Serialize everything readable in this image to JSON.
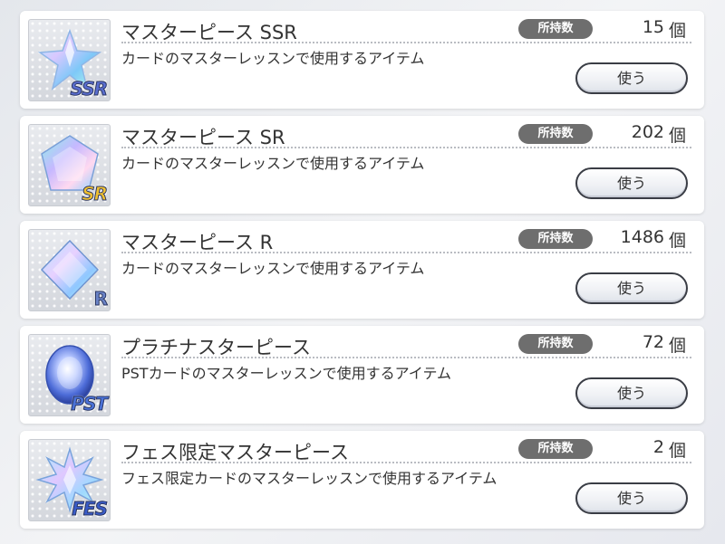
{
  "items": [
    {
      "name": "マスターピース SSR",
      "description": "カードのマスターレッスンで使用するアイテム",
      "own_label": "所持数",
      "count": "15",
      "unit": "個",
      "button": "使う",
      "badge": "SSR",
      "icon": "ssr-star-crystal-icon"
    },
    {
      "name": "マスターピース SR",
      "description": "カードのマスターレッスンで使用するアイテム",
      "own_label": "所持数",
      "count": "202",
      "unit": "個",
      "button": "使う",
      "badge": "SR",
      "icon": "sr-pentagon-crystal-icon"
    },
    {
      "name": "マスターピース R",
      "description": "カードのマスターレッスンで使用するアイテム",
      "own_label": "所持数",
      "count": "1486",
      "unit": "個",
      "button": "使う",
      "badge": "R",
      "icon": "r-diamond-crystal-icon"
    },
    {
      "name": "プラチナスターピース",
      "description": "PSTカードのマスターレッスンで使用するアイテム",
      "own_label": "所持数",
      "count": "72",
      "unit": "個",
      "button": "使う",
      "badge": "PST",
      "icon": "pst-oval-gem-icon"
    },
    {
      "name": "フェス限定マスターピース",
      "description": "フェス限定カードのマスターレッスンで使用するアイテム",
      "own_label": "所持数",
      "count": "2",
      "unit": "個",
      "button": "使う",
      "badge": "FES",
      "icon": "fes-starburst-crystal-icon"
    }
  ],
  "colors": {
    "own_label_bg": "#6e6e6e",
    "card_bg": "#ffffff",
    "button_border": "#3a3d45"
  }
}
